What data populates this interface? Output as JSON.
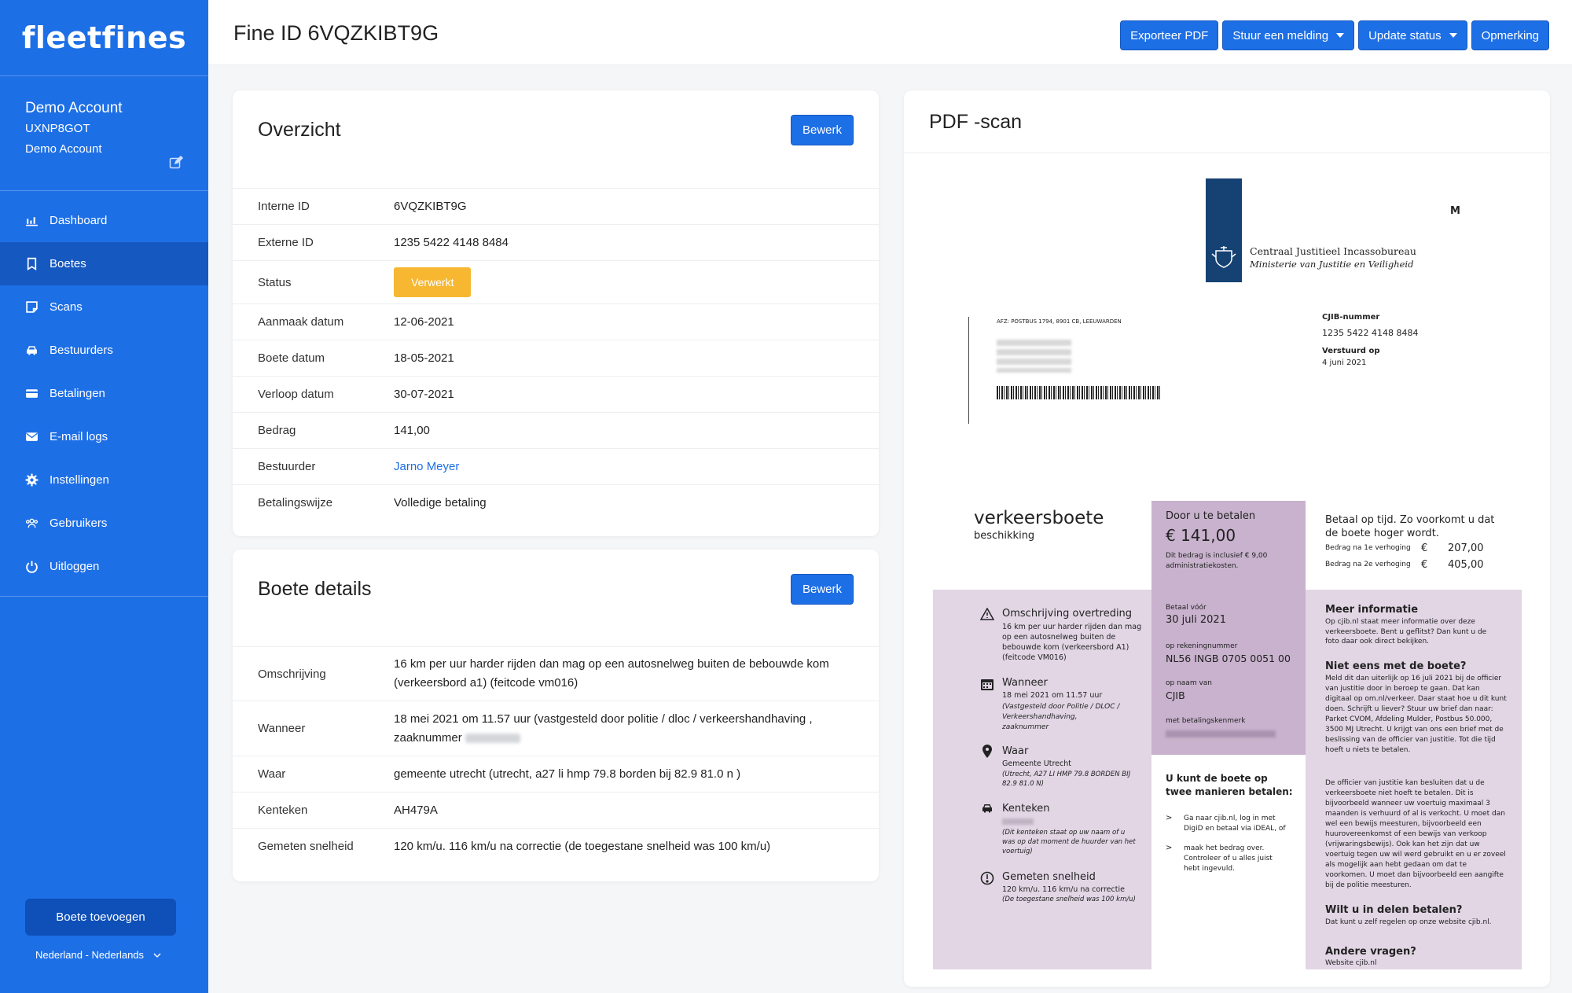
{
  "sidebar": {
    "logo": "fleetfines",
    "account_name": "Demo Account",
    "account_id": "UXNP8GOT",
    "account_sub": "Demo Account",
    "items": [
      {
        "label": "Dashboard",
        "icon": "chart-icon"
      },
      {
        "label": "Boetes",
        "icon": "bookmark-icon"
      },
      {
        "label": "Scans",
        "icon": "scan-icon"
      },
      {
        "label": "Bestuurders",
        "icon": "car-icon"
      },
      {
        "label": "Betalingen",
        "icon": "credit-card-icon"
      },
      {
        "label": "E-mail logs",
        "icon": "envelope-icon"
      },
      {
        "label": "Instellingen",
        "icon": "gear-icon"
      },
      {
        "label": "Gebruikers",
        "icon": "users-icon"
      },
      {
        "label": "Uitloggen",
        "icon": "power-icon"
      }
    ],
    "active_index": 1,
    "add_button": "Boete toevoegen",
    "language": "Nederland - Nederlands"
  },
  "header": {
    "title": "Fine ID 6VQZKIBT9G",
    "actions": {
      "export": "Exporteer PDF",
      "notify": "Stuur een melding",
      "status": "Update status",
      "remark": "Opmerking"
    }
  },
  "overview": {
    "title": "Overzicht",
    "edit": "Bewerk",
    "rows": [
      {
        "k": "Interne ID",
        "v": "6VQZKIBT9G"
      },
      {
        "k": "Externe ID",
        "v": "1235 5422 4148 8484"
      },
      {
        "k": "Status",
        "v": "Verwerkt"
      },
      {
        "k": "Aanmaak datum",
        "v": "12-06-2021"
      },
      {
        "k": "Boete datum",
        "v": "18-05-2021"
      },
      {
        "k": "Verloop datum",
        "v": "30-07-2021"
      },
      {
        "k": "Bedrag",
        "v": "141,00"
      },
      {
        "k": "Bestuurder",
        "v": "Jarno Meyer"
      },
      {
        "k": "Betalingswijze",
        "v": "Volledige betaling"
      }
    ]
  },
  "details": {
    "title": "Boete details",
    "edit": "Bewerk",
    "rows": [
      {
        "k": "Omschrijving",
        "v": "16 km per uur harder rijden dan mag op een autosnelweg buiten de bebouwde kom (verkeersbord a1) (feitcode vm016)"
      },
      {
        "k": "Wanneer",
        "v": "18 mei 2021 om 11.57 uur (vastgesteld door politie / dloc / verkeershandhaving , zaaknummer"
      },
      {
        "k": "Waar",
        "v": "gemeente utrecht (utrecht, a27 li hmp 79.8 borden bij 82.9 81.0 n )"
      },
      {
        "k": "Kenteken",
        "v": "AH479A"
      },
      {
        "k": "Gemeten snelheid",
        "v": "120 km/u. 116 km/u na correctie (de toegestane snelheid was 100 km/u)"
      }
    ]
  },
  "pdf": {
    "title": "PDF -scan",
    "org1": "Centraal Justitieel Incassobureau",
    "org2": "Ministerie van Justitie en Veiligheid",
    "corner": "M",
    "afz": "AFZ: POSTBUS 1794, 8901 CB, LEEUWARDEN",
    "cjib_label": "CJIB-nummer",
    "cjib_value": "1235 5422 4148 8484",
    "sent_label": "Verstuurd op",
    "sent_value": "4 juni 2021",
    "doc_title": "verkeersboete",
    "doc_sub": "beschikking",
    "pay_label": "Door u te betalen",
    "pay_amount": "€ 141,00",
    "pay_note": "Dit bedrag is inclusief € 9,00 administratiekosten.",
    "ontime": "Betaal op tijd. Zo voorkomt u dat de boete hoger wordt.",
    "raise1_label": "Bedrag na 1e verhoging",
    "raise1_cur": "€",
    "raise1_value": "207,00",
    "raise2_label": "Bedrag na 2e verhoging",
    "raise2_cur": "€",
    "raise2_value": "405,00",
    "offense_title": "Omschrijving overtreding",
    "offense_text": "16 km per uur harder rijden dan mag op een autosnelweg buiten de bebouwde kom (verkeersbord A1) (feitcode VM016)",
    "when_title": "Wanneer",
    "when_text": "18 mei 2021 om 11.57 uur",
    "when_note": "(Vastgesteld door Politie / DLOC / Verkeershandhaving, zaaknummer",
    "where_title": "Waar",
    "where_text": "Gemeente Utrecht",
    "where_note": "(Utrecht, A27 LI HMP 79.8 BORDEN BIJ 82.9 81.0 N)",
    "plate_title": "Kenteken",
    "plate_note": "(Dit kenteken staat op uw naam of u was op dat moment de huurder van het voertuig)",
    "speed_title": "Gemeten snelheid",
    "speed_text": "120 km/u. 116 km/u na correctie",
    "speed_note": "(De toegestane snelheid was 100 km/u)",
    "before_label": "Betaal vóór",
    "before_value": "30 juli 2021",
    "account_label": "op rekeningnummer",
    "account_value": "NL56 INGB 0705 0051 00",
    "name_label": "op naam van",
    "name_value": "CJIB",
    "ref_label": "met betalingskenmerk",
    "ways_title": "U kunt de boete op twee manieren betalen:",
    "way1": "Ga naar cjib.nl, log in met DigiD en betaal via iDEAL, of",
    "way2": "maak het bedrag over. Controleer of u alles juist hebt ingevuld.",
    "more_title": "Meer informatie",
    "more_text": "Op cjib.nl staat meer informatie over deze verkeersboete. Bent u geflitst? Dan kunt u de foto daar ook direct bekijken.",
    "disagree_title": "Niet eens met de boete?",
    "disagree_text": "Meld dit dan uiterlijk op 16 juli 2021 bij de officier van justitie door in beroep te gaan. Dat kan digitaal op om.nl/verkeer. Daar staat hoe u dit kunt doen. Schrijft u liever? Stuur uw brief dan naar: Parket CVOM, Afdeling Mulder, Postbus 50.000, 3500 MJ Utrecht. U krijgt van ons een brief met de beslissing van de officier van justitie. Tot die tijd hoeft u niets te betalen.",
    "officer_text": "De officier van justitie kan besluiten dat u de verkeersboete niet hoeft te betalen. Dit is bijvoorbeeld wanneer uw voertuig maximaal 3 maanden is verhuurd of al is verkocht. U moet dan wel een bewijs meesturen, bijvoorbeeld een huurovereenkomst of een bewijs van verkoop (vrijwaringsbewijs). Ook kan het zijn dat uw voertuig tegen uw wil werd gebruikt en u er zoveel als mogelijk aan hebt gedaan om dat te voorkomen. U moet dan bijvoorbeeld een aangifte bij de politie meesturen.",
    "parts_title": "Wilt u in delen betalen?",
    "parts_text": "Dat kunt u zelf regelen op onze website cjib.nl.",
    "questions_title": "Andere vragen?",
    "website": "Website  cjib.nl"
  },
  "colors": {
    "primary": "#1d6fe6",
    "status": "#f7b731",
    "pdf_purple": "#e2d6e5",
    "pdf_purple_dark": "#c8b2cd"
  }
}
